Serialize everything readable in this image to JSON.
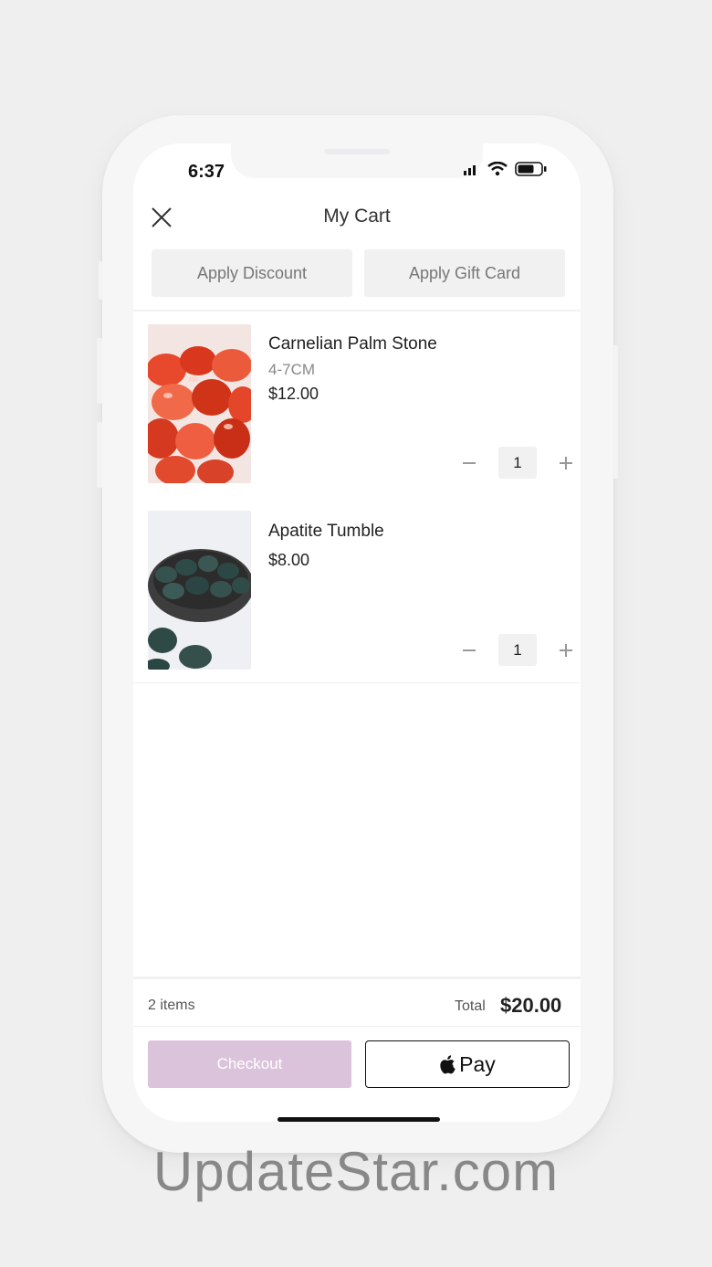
{
  "status_bar": {
    "time": "6:37"
  },
  "header": {
    "title": "My Cart",
    "close_icon": "close-icon"
  },
  "actions": {
    "discount_label": "Apply Discount",
    "gift_card_label": "Apply Gift Card"
  },
  "cart": {
    "items": [
      {
        "name": "Carnelian Palm Stone",
        "variant": "4-7CM",
        "price": "$12.00",
        "quantity": "1"
      },
      {
        "name": "Apatite Tumble",
        "price": "$8.00",
        "quantity": "1"
      }
    ]
  },
  "summary": {
    "items_count": "2 items",
    "total_label": "Total",
    "total_value": "$20.00"
  },
  "footer": {
    "checkout_label": "Checkout",
    "applepay_label": "Pay"
  },
  "watermark": "UpdateStar.com",
  "colors": {
    "checkout_bg": "#dcc3dc",
    "screen_bg": "#ffffff",
    "pill_bg": "#f1f1f2"
  }
}
